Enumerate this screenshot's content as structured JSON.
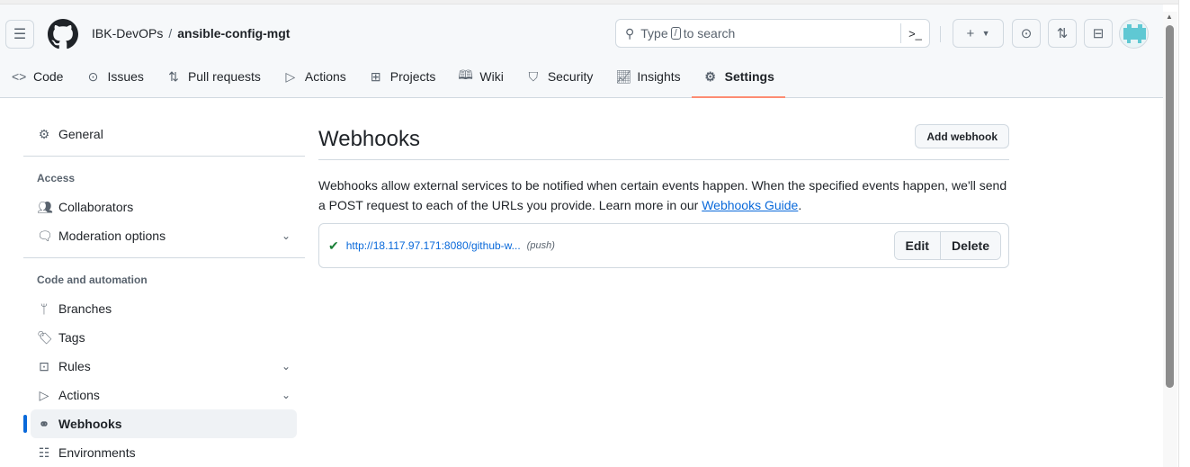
{
  "header": {
    "owner": "IBK-DevOPs",
    "separator": "/",
    "repo": "ansible-config-mgt",
    "search_prefix": "Type",
    "search_key": "/",
    "search_suffix": "to search"
  },
  "tabs": [
    {
      "label": "Code",
      "icon": "code-icon"
    },
    {
      "label": "Issues",
      "icon": "issue-icon"
    },
    {
      "label": "Pull requests",
      "icon": "pull-request-icon"
    },
    {
      "label": "Actions",
      "icon": "play-icon"
    },
    {
      "label": "Projects",
      "icon": "table-icon"
    },
    {
      "label": "Wiki",
      "icon": "book-icon"
    },
    {
      "label": "Security",
      "icon": "shield-icon"
    },
    {
      "label": "Insights",
      "icon": "graph-icon"
    },
    {
      "label": "Settings",
      "icon": "gear-icon"
    }
  ],
  "sidebar": {
    "general": "General",
    "access_heading": "Access",
    "collaborators": "Collaborators",
    "moderation": "Moderation options",
    "code_heading": "Code and automation",
    "branches": "Branches",
    "tags": "Tags",
    "rules": "Rules",
    "actions": "Actions",
    "webhooks": "Webhooks",
    "environments": "Environments"
  },
  "main": {
    "title": "Webhooks",
    "add_button": "Add webhook",
    "desc1": "Webhooks allow external services to be notified when certain events happen. When the specified events happen, we'll send a POST request to each of the URLs you provide. Learn more in our ",
    "guide_link": "Webhooks Guide",
    "desc2": ".",
    "hooks": [
      {
        "url": "http://18.117.97.171:8080/github-w...",
        "events": "(push)",
        "status": "success",
        "edit": "Edit",
        "delete": "Delete"
      }
    ]
  },
  "colors": {
    "accent": "#0969da",
    "underline": "#fd8c73",
    "success": "#1a7f37"
  }
}
